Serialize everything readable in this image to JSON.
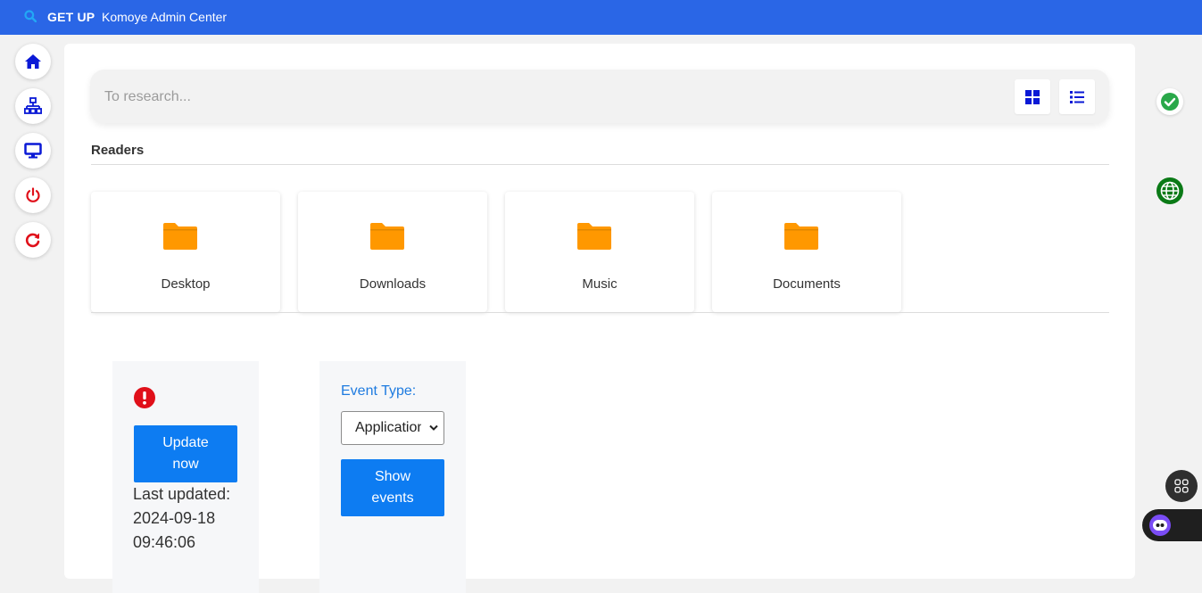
{
  "app": {
    "brand": "GET UP",
    "subtitle": "Komoye Admin Center"
  },
  "sidebar": {
    "items": [
      {
        "name": "home-icon",
        "color": "#0a19d6"
      },
      {
        "name": "network-icon",
        "color": "#0a19d6"
      },
      {
        "name": "monitor-icon",
        "color": "#0a19d6"
      },
      {
        "name": "power-icon",
        "color": "#e0101a"
      },
      {
        "name": "refresh-icon",
        "color": "#e0101a"
      }
    ]
  },
  "search": {
    "placeholder": "To research..."
  },
  "readers": {
    "title": "Readers",
    "folders": [
      {
        "label": "Desktop"
      },
      {
        "label": "Downloads"
      },
      {
        "label": "Music"
      },
      {
        "label": "Documents"
      }
    ]
  },
  "update_card": {
    "button_line1": "Update",
    "button_line2": "now",
    "last_updated_label": "Last updated:",
    "last_updated_date": "2024-09-18",
    "last_updated_time": "09:46:06"
  },
  "events_card": {
    "label": "Event Type:",
    "selected": "Application",
    "button_line1": "Show",
    "button_line2": "events"
  },
  "colors": {
    "topbar": "#2a66e6",
    "accent_blue": "#0d7cf2",
    "folder": "#ff9800",
    "danger": "#e0101a",
    "success": "#2aa84a"
  }
}
